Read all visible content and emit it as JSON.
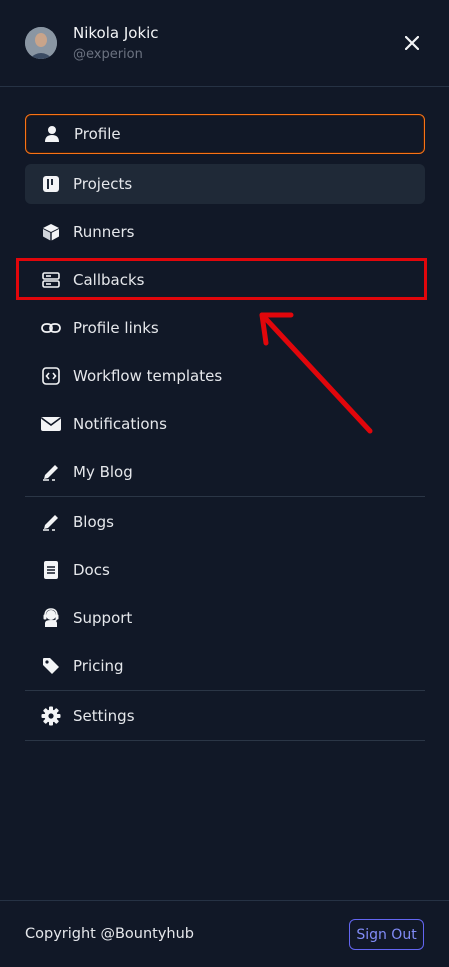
{
  "user": {
    "name": "Nikola Jokic",
    "handle": "@experion"
  },
  "nav": {
    "primary": [
      {
        "label": "Profile",
        "icon": "user-icon",
        "state": "active"
      },
      {
        "label": "Projects",
        "icon": "projects-icon",
        "state": "hover"
      },
      {
        "label": "Runners",
        "icon": "cube-icon",
        "state": "normal"
      },
      {
        "label": "Callbacks",
        "icon": "server-icon",
        "state": "normal"
      },
      {
        "label": "Profile links",
        "icon": "link-icon",
        "state": "normal"
      },
      {
        "label": "Workflow templates",
        "icon": "code-icon",
        "state": "normal"
      },
      {
        "label": "Notifications",
        "icon": "envelope-icon",
        "state": "normal"
      },
      {
        "label": "My Blog",
        "icon": "pen-icon",
        "state": "normal"
      }
    ],
    "secondary": [
      {
        "label": "Blogs",
        "icon": "pen-icon"
      },
      {
        "label": "Docs",
        "icon": "document-icon"
      },
      {
        "label": "Support",
        "icon": "headset-icon"
      },
      {
        "label": "Pricing",
        "icon": "tag-icon"
      }
    ],
    "tertiary": [
      {
        "label": "Settings",
        "icon": "gear-icon"
      }
    ]
  },
  "footer": {
    "copyright": "Copyright @Bountyhub",
    "signout_label": "Sign Out"
  },
  "colors": {
    "background": "#111827",
    "active_border": "#f97316",
    "annotation_red": "#e1060b",
    "signout_accent": "#818cf8"
  }
}
